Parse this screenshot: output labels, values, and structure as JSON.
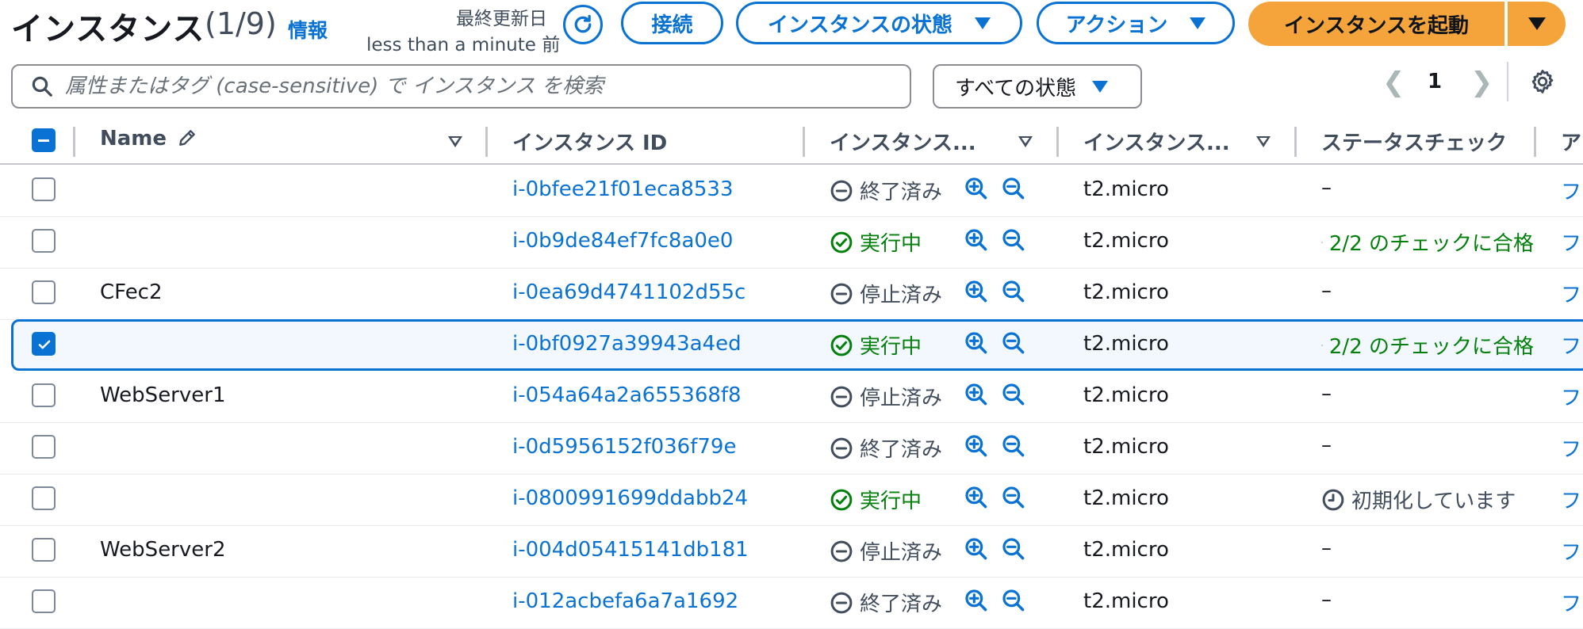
{
  "header": {
    "title": "インスタンス",
    "count": "(1/9)",
    "info_link": "情報",
    "last_updated_label": "最終更新日",
    "last_updated_value": "less than a minute 前"
  },
  "buttons": {
    "connect": "接続",
    "instance_state": "インスタンスの状態",
    "actions": "アクション",
    "launch": "インスタンスを起動"
  },
  "search": {
    "placeholder": "属性またはタグ (case-sensitive) で インスタンス を検索"
  },
  "state_filter": {
    "selected": "すべての状態"
  },
  "pagination": {
    "current_page": "1"
  },
  "columns": {
    "name": "Name",
    "instance_id": "インスタンス ID",
    "instance_state": "インスタンス...",
    "instance_type": "インスタンス...",
    "status_check": "ステータスチェック"
  },
  "rows": [
    {
      "name": "",
      "id": "i-0bfee21f01eca8533",
      "state": "終了済み",
      "type": "t2.micro",
      "status": "–"
    },
    {
      "name": "",
      "id": "i-0b9de84ef7fc8a0e0",
      "state": "実行中",
      "type": "t2.micro",
      "status": "2/2 のチェックに合格"
    },
    {
      "name": "CFec2",
      "id": "i-0ea69d4741102d55c",
      "state": "停止済み",
      "type": "t2.micro",
      "status": "–"
    },
    {
      "name": "",
      "id": "i-0bf0927a39943a4ed",
      "state": "実行中",
      "type": "t2.micro",
      "status": "2/2 のチェックに合格"
    },
    {
      "name": "WebServer1",
      "id": "i-054a64a2a655368f8",
      "state": "停止済み",
      "type": "t2.micro",
      "status": "–"
    },
    {
      "name": "",
      "id": "i-0d5956152f036f79e",
      "state": "終了済み",
      "type": "t2.micro",
      "status": "–"
    },
    {
      "name": "",
      "id": "i-0800991699ddabb24",
      "state": "実行中",
      "type": "t2.micro",
      "status": "初期化しています"
    },
    {
      "name": "WebServer2",
      "id": "i-004d05415141db181",
      "state": "停止済み",
      "type": "t2.micro",
      "status": "–"
    },
    {
      "name": "",
      "id": "i-012acbefa6a7a1692",
      "state": "終了済み",
      "type": "t2.micro",
      "status": "–"
    }
  ],
  "colors": {
    "link": "#0972d3",
    "primary_button": "#f5a43c",
    "running": "#037f0c",
    "neutral": "#414d5c"
  }
}
